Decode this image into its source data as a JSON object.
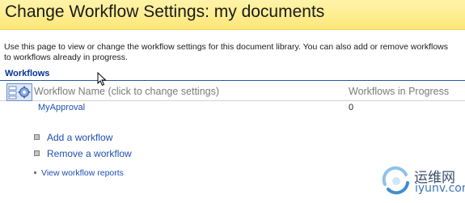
{
  "page": {
    "title": "Change Workflow Settings: my documents",
    "description_lines": [
      "Use this page to view or change the workflow settings for this document library. You can also add or remove workflows",
      "to workflows already in progress."
    ]
  },
  "section": {
    "title": "Workflows"
  },
  "table": {
    "columns": [
      "Workflow Name (click to change settings)",
      "Workflows in Progress"
    ],
    "rows": [
      {
        "name": "MyApproval",
        "in_progress": "0"
      }
    ]
  },
  "actions": {
    "add_label": "Add a workflow",
    "remove_label": "Remove a workflow",
    "reports_label": "View workflow reports"
  },
  "icons": {
    "table_header_icon": "workflow-settings-icon",
    "cursor": "mouse-pointer-icon",
    "watermark_logo": "watermark-logo-icon"
  },
  "watermark": {
    "text_cn": "运维网",
    "text_en": "iyunv.com"
  },
  "colors": {
    "title_bar_bg": "#fde77a",
    "link": "#1f4fb2",
    "section_title": "#003399",
    "section_rule": "#2d56a4",
    "header_text": "#7a7a7a"
  }
}
